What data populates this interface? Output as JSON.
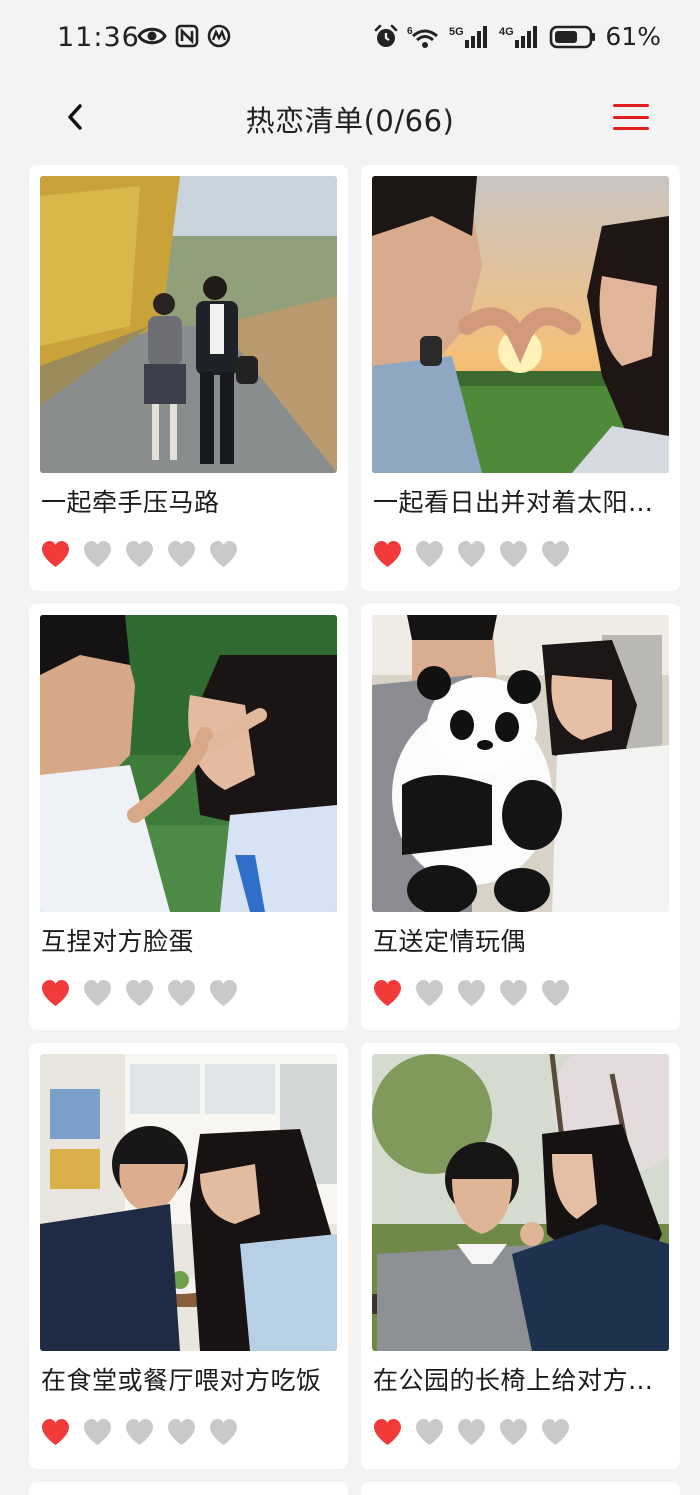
{
  "status_bar": {
    "time": "11:36",
    "battery": "61%",
    "left_icons": [
      "eye-icon",
      "nfc-icon",
      "app-notification-icon"
    ],
    "right_icons": [
      "alarm-icon",
      "wifi-icon",
      "signal-5g-icon",
      "signal-4g-icon",
      "battery-icon"
    ],
    "network_labels": [
      "6",
      "5G",
      "4G"
    ]
  },
  "header": {
    "title": "热恋清单(0/66)",
    "back_icon": "chevron-left-icon",
    "menu_icon": "hamburger-menu-icon",
    "menu_color": "#e11d1d"
  },
  "colors": {
    "heart_active": "#f23a3a",
    "heart_inactive": "#c9c9c9",
    "background": "#f3f3f3",
    "card": "#ffffff"
  },
  "cards": [
    {
      "title": "一起牵手压马路",
      "rating": 1,
      "max_rating": 5,
      "photo": "couple walking on country road in school uniforms"
    },
    {
      "title": "一起看日出并对着太阳比心",
      "rating": 1,
      "max_rating": 5,
      "photo": "couple making heart shape with hands at sunrise"
    },
    {
      "title": "互捏对方脸蛋",
      "rating": 1,
      "max_rating": 5,
      "photo": "girl touching boy's face outdoors"
    },
    {
      "title": "互送定情玩偶",
      "rating": 1,
      "max_rating": 5,
      "photo": "couple holding a panda plush toy"
    },
    {
      "title": "在食堂或餐厅喂对方吃饭",
      "rating": 1,
      "max_rating": 5,
      "photo": "couple feeding each other in cafeteria"
    },
    {
      "title": "在公园的长椅上给对方捏肩",
      "rating": 1,
      "max_rating": 5,
      "photo": "couple on a park bench"
    }
  ]
}
